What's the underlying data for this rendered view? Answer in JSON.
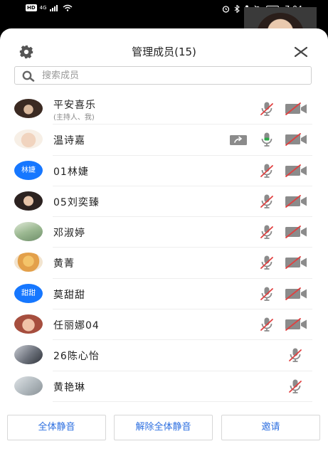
{
  "status_bar": {
    "left_badge": "HD",
    "network": "4G",
    "time": "7:04"
  },
  "header": {
    "title": "管理成员(15)"
  },
  "search": {
    "placeholder": "搜索成员"
  },
  "members": [
    {
      "name": "平安喜乐",
      "sub": "(主持人、我)",
      "avatar": "photo-woman-hair",
      "mic": "muted",
      "camera": "off",
      "share": false
    },
    {
      "name": "温诗嘉",
      "sub": "",
      "avatar": "photo-baby",
      "mic": "on",
      "camera": "off",
      "share": true
    },
    {
      "name": "01林婕",
      "sub": "",
      "avatar_text": "林婕",
      "mic": "muted",
      "camera": "off",
      "share": false
    },
    {
      "name": "05刘奕臻",
      "sub": "",
      "avatar": "photo-girl",
      "mic": "muted",
      "camera": "off",
      "share": false
    },
    {
      "name": "邓淑婷",
      "sub": "",
      "avatar": "photo-landscape",
      "mic": "muted",
      "camera": "off",
      "share": false
    },
    {
      "name": "黄菁",
      "sub": "",
      "avatar": "photo-cartoon",
      "mic": "muted",
      "camera": "off",
      "share": false
    },
    {
      "name": "莫甜甜",
      "sub": "",
      "avatar_text": "甜甜",
      "mic": "muted",
      "camera": "off",
      "share": false
    },
    {
      "name": "任丽娜04",
      "sub": "",
      "avatar": "photo-baby-face",
      "mic": "muted",
      "camera": "off",
      "share": false
    },
    {
      "name": "26陈心怡",
      "sub": "",
      "avatar": "photo-room",
      "mic": "muted",
      "camera": "none",
      "share": false
    },
    {
      "name": "黄艳琳",
      "sub": "",
      "avatar": "photo-landscape-2",
      "mic": "muted",
      "camera": "none",
      "share": false
    }
  ],
  "actions": {
    "mute_all": "全体静音",
    "unmute_all": "解除全体静音",
    "invite": "邀请"
  },
  "colors": {
    "accent": "#2d6fe0",
    "avatar_blue": "#1677ff",
    "muted_red": "#e04040",
    "mic_on_green": "#2ea84a"
  }
}
